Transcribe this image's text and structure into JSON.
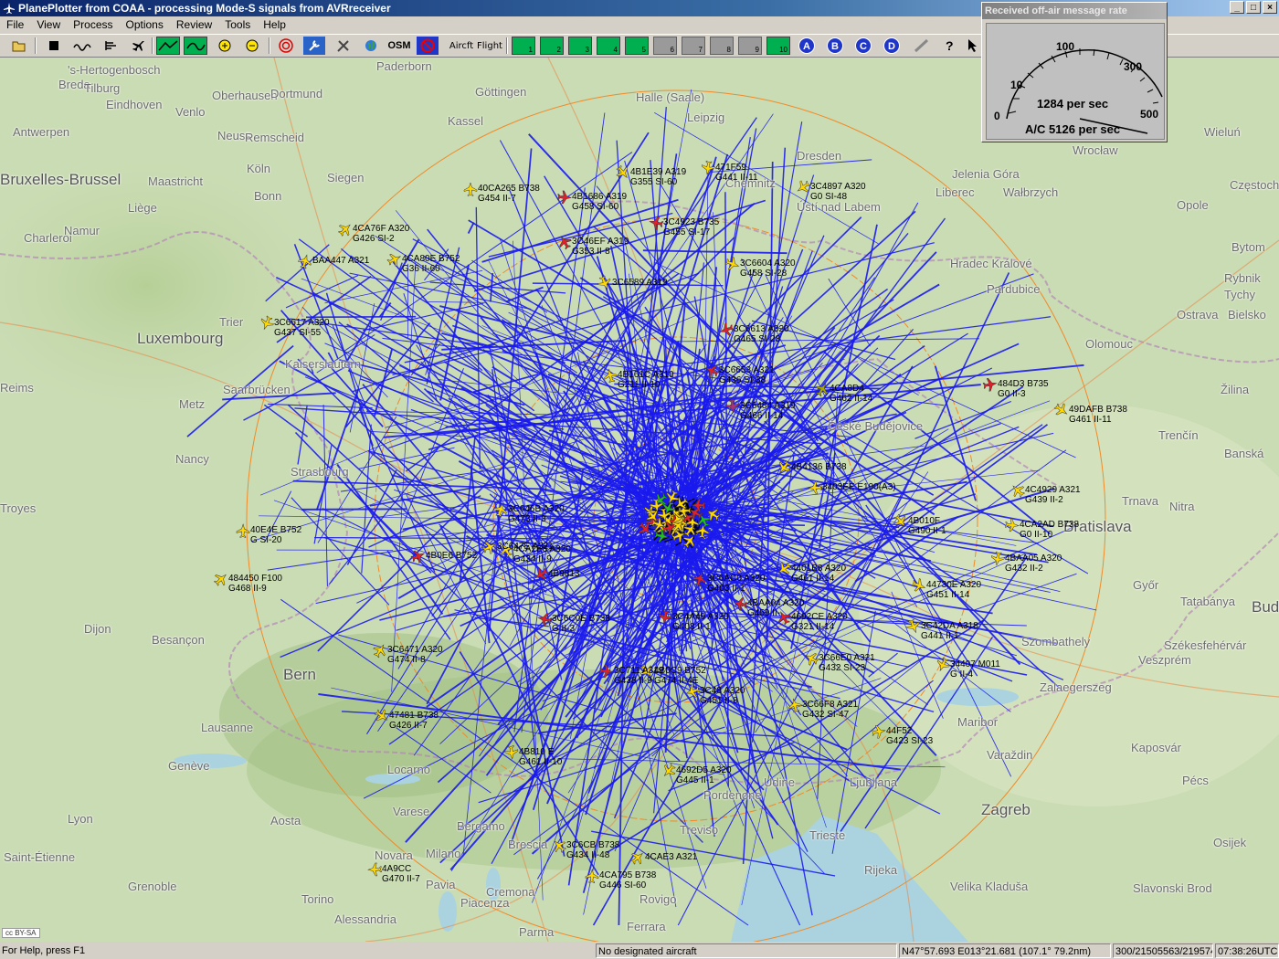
{
  "window": {
    "title": "PlanePlotter from COAA - processing Mode-S signals from AVRreceiver",
    "buttons": [
      "_",
      "□",
      "×"
    ]
  },
  "menu": [
    "File",
    "View",
    "Process",
    "Options",
    "Review",
    "Tools",
    "Help"
  ],
  "toolbar": {
    "osm_label": "OSM",
    "aircraft_label": "Aircft",
    "flight_label": "Flight",
    "numbered_buttons": [
      "1",
      "2",
      "3",
      "4",
      "5",
      "6",
      "7",
      "8",
      "9",
      "10"
    ],
    "letter_buttons": [
      "A",
      "B",
      "C",
      "D"
    ],
    "icons": [
      "open-folder-icon",
      "stop-icon",
      "wave-icon",
      "bars-icon",
      "plane-icon",
      "map-green-icon",
      "chart-green-icon",
      "zoom-in-icon",
      "zoom-out-icon",
      "target-icon",
      "wrench-icon",
      "tools-icon",
      "globe-icon",
      "no-entry-icon",
      "pencil-icon",
      "help-icon",
      "arrow-cursor-icon"
    ]
  },
  "gauge": {
    "title": "Received off-air message rate",
    "ticks": [
      "0",
      "10",
      "100",
      "300",
      "500"
    ],
    "rate": "1284 per sec",
    "ac_rate": "A/C 5126 per sec",
    "needle_value": 1284
  },
  "map": {
    "attribution": "cc BY-SA",
    "cities": [
      {
        "name": "'s-Hertogenbosch"
      },
      {
        "name": "Breda"
      },
      {
        "name": "Tilburg"
      },
      {
        "name": "Eindhoven"
      },
      {
        "name": "Oberhausen"
      },
      {
        "name": "Dortmund"
      },
      {
        "name": "Venlo"
      },
      {
        "name": "Antwerpen"
      },
      {
        "name": "Neuss"
      },
      {
        "name": "Remscheid"
      },
      {
        "name": "Köln"
      },
      {
        "name": "Siegen"
      },
      {
        "name": "Bonn"
      },
      {
        "name": "Liège"
      },
      {
        "name": "Maastricht"
      },
      {
        "name": "Charleroi"
      },
      {
        "name": "Namur"
      },
      {
        "name": "Trier"
      },
      {
        "name": "Luxembourg"
      },
      {
        "name": "Reims"
      },
      {
        "name": "Metz"
      },
      {
        "name": "Nancy"
      },
      {
        "name": "Strasbourg"
      },
      {
        "name": "Troyes"
      },
      {
        "name": "Dijon"
      },
      {
        "name": "Besançon"
      },
      {
        "name": "Bern"
      },
      {
        "name": "Lausanne"
      },
      {
        "name": "Genève"
      },
      {
        "name": "Lyon"
      },
      {
        "name": "Saint-Étienne"
      },
      {
        "name": "Grenoble"
      },
      {
        "name": "Aosta"
      },
      {
        "name": "Novara"
      },
      {
        "name": "Milano"
      },
      {
        "name": "Torino"
      },
      {
        "name": "Alessandria"
      },
      {
        "name": "Pavia"
      },
      {
        "name": "Cremona"
      },
      {
        "name": "Piacenza"
      },
      {
        "name": "Parma"
      },
      {
        "name": "Ferrara"
      },
      {
        "name": "Rovigo"
      },
      {
        "name": "Brescia"
      },
      {
        "name": "Bergamo"
      },
      {
        "name": "Locarno"
      },
      {
        "name": "Varese"
      },
      {
        "name": "Udine"
      },
      {
        "name": "Pordenone"
      },
      {
        "name": "Treviso"
      },
      {
        "name": "Trieste"
      },
      {
        "name": "Rijeka"
      },
      {
        "name": "Ljubljana"
      },
      {
        "name": "Zagreb"
      },
      {
        "name": "Velika Kladuša"
      },
      {
        "name": "Slavonski Brod"
      },
      {
        "name": "Osijek"
      },
      {
        "name": "Pécs"
      },
      {
        "name": "Kaposvár"
      },
      {
        "name": "Varaždin"
      },
      {
        "name": "Maribor"
      },
      {
        "name": "Zalaegerszeg"
      },
      {
        "name": "Szombathely"
      },
      {
        "name": "Veszprém"
      },
      {
        "name": "Székesfehérvár"
      },
      {
        "name": "Buda"
      },
      {
        "name": "Tatabánya"
      },
      {
        "name": "Győr"
      },
      {
        "name": "Bratislava"
      },
      {
        "name": "Nitra"
      },
      {
        "name": "Trnava"
      },
      {
        "name": "Banská"
      },
      {
        "name": "Trenčín"
      },
      {
        "name": "Žilina"
      },
      {
        "name": "Olomouc"
      },
      {
        "name": "Ostrava"
      },
      {
        "name": "Bielsko"
      },
      {
        "name": "Rybnik"
      },
      {
        "name": "Tychy"
      },
      {
        "name": "Bytom"
      },
      {
        "name": "Opole"
      },
      {
        "name": "Wrocław"
      },
      {
        "name": "Wałbrzych"
      },
      {
        "name": "Jelenia Góra"
      },
      {
        "name": "Liberec"
      },
      {
        "name": "Hradec Králové"
      },
      {
        "name": "Pardubice"
      },
      {
        "name": "České Budějovice"
      },
      {
        "name": "Dresden"
      },
      {
        "name": "Chemnitz"
      },
      {
        "name": "Halle (Saale)"
      },
      {
        "name": "Leipzig"
      },
      {
        "name": "Göttingen"
      },
      {
        "name": "Kassel"
      },
      {
        "name": "Paderborn"
      },
      {
        "name": "Wieluń"
      },
      {
        "name": "Częstochowa"
      },
      {
        "name": "Kaiserslautern"
      },
      {
        "name": "Saarbrücken"
      },
      {
        "name": "Bruxelles-Brussel"
      },
      {
        "name": "Ústí nad Labem"
      }
    ],
    "aircraft": [
      {
        "l1": "40CA265 B738",
        "l2": "G454 II-7"
      },
      {
        "l1": "4CA76F A320",
        "l2": "G426 SI-2"
      },
      {
        "l1": "4B1686 A319",
        "l2": "G458 SI-60"
      },
      {
        "l1": "4B1E39 A319",
        "l2": "G355 SI-60"
      },
      {
        "l1": "471F59",
        "l2": "G441 II-11"
      },
      {
        "l1": "3C4897 A320",
        "l2": "G0 SI-48"
      },
      {
        "l1": "3C4923 B735",
        "l2": "G455 SI-17"
      },
      {
        "l1": "3C46EF A319",
        "l2": "G353 II-8"
      },
      {
        "l1": "BAA447 A321",
        "l2": ""
      },
      {
        "l1": "4CA80E B752",
        "l2": "G36 II-60"
      },
      {
        "l1": "3C6604 A320",
        "l2": "G458 SI-28"
      },
      {
        "l1": "3C6589 A319",
        "l2": ""
      },
      {
        "l1": "3C6617 A320",
        "l2": "G437 SI-55"
      },
      {
        "l1": "3C6613 A320",
        "l2": "G465 SI-28"
      },
      {
        "l1": "3C6653 A321",
        "l2": "G436 SI-38"
      },
      {
        "l1": "4B161C A319",
        "l2": "G211 II-10"
      },
      {
        "l1": "4CA8D4",
        "l2": "G462 II-14"
      },
      {
        "l1": "484D3 B735",
        "l2": "G0 II-3"
      },
      {
        "l1": "49DAFB B738",
        "l2": "G461 II-11"
      },
      {
        "l1": "3C6484 A319",
        "l2": "G466 II-14"
      },
      {
        "l1": "4B4136 B738",
        "l2": ""
      },
      {
        "l1": "3403EE E190(A3)",
        "l2": ""
      },
      {
        "l1": "4C4929 A321",
        "l2": "G439 II-2"
      },
      {
        "l1": "40E4E B752",
        "l2": "G SI-20"
      },
      {
        "l1": "484450 F100",
        "l2": "G468 II-9"
      },
      {
        "l1": "4CA2AD B738",
        "l2": "G0 II-10"
      },
      {
        "l1": "4B010F",
        "l2": "G490 II-1"
      },
      {
        "l1": "4BAA05 A320",
        "l2": "G432 II-2"
      },
      {
        "l1": "4401B8 A320",
        "l2": "G461 II-14"
      },
      {
        "l1": "4BAA04 A320",
        "l2": "G459 II-"
      },
      {
        "l1": "4692CE A320",
        "l2": "G321 II-14"
      },
      {
        "l1": "3C646B A320",
        "l2": "G473 II-3"
      },
      {
        "l1": "3C647E A321",
        "l2": ""
      },
      {
        "l1": "44730E A320",
        "l2": "G451 II-14"
      },
      {
        "l1": "3C42DA A318",
        "l2": "G441 II-1"
      },
      {
        "l1": "34407 M011",
        "l2": "G II-4"
      },
      {
        "l1": "3C48 A320",
        "l2": "G451 II-8"
      },
      {
        "l1": "3C66E0 A321",
        "l2": "G432 SI-23"
      },
      {
        "l1": "3C66F8 A321",
        "l2": "G432 SI-47"
      },
      {
        "l1": "3C6471 A320",
        "l2": "G474 II-8"
      },
      {
        "l1": "44F52",
        "l2": "G423 SI-23"
      },
      {
        "l1": "47481 B738",
        "l2": "G426 II-7"
      },
      {
        "l1": "4B810 E",
        "l2": "G461 II-10"
      },
      {
        "l1": "4692D5 A320",
        "l2": "G445 II-1"
      },
      {
        "l1": "4A9CC",
        "l2": "G470 II-7"
      },
      {
        "l1": "3C6CB B738",
        "l2": "G434 II-48"
      },
      {
        "l1": "4CA795 B738",
        "l2": "G446 SI-60"
      },
      {
        "l1": "4CAE3 A321",
        "l2": ""
      },
      {
        "l1": "3C711 A319",
        "l2": "G438 II-9"
      },
      {
        "l1": "4B0C9 B752",
        "l2": "G474 II-4E"
      },
      {
        "l1": "3C4A49 A320",
        "l2": "G408 II-1"
      },
      {
        "l1": "4B9813",
        "l2": ""
      },
      {
        "l1": "3C6C0E B738",
        "l2": "G II-3"
      },
      {
        "l1": "4CA2E8 A320",
        "l2": "G434 II-9"
      },
      {
        "l1": "3C6AC0 A320",
        "l2": "G403 II-1"
      },
      {
        "l1": "4B0E6 B752",
        "l2": ""
      }
    ]
  },
  "status": {
    "help": "For Help, press F1",
    "designated": "No designated aircraft",
    "position": "N47°57.693 E013°21.681 (107.1°  79.2nm)",
    "counts": "300/21505563/219574",
    "time": "07:38:26UTC"
  }
}
